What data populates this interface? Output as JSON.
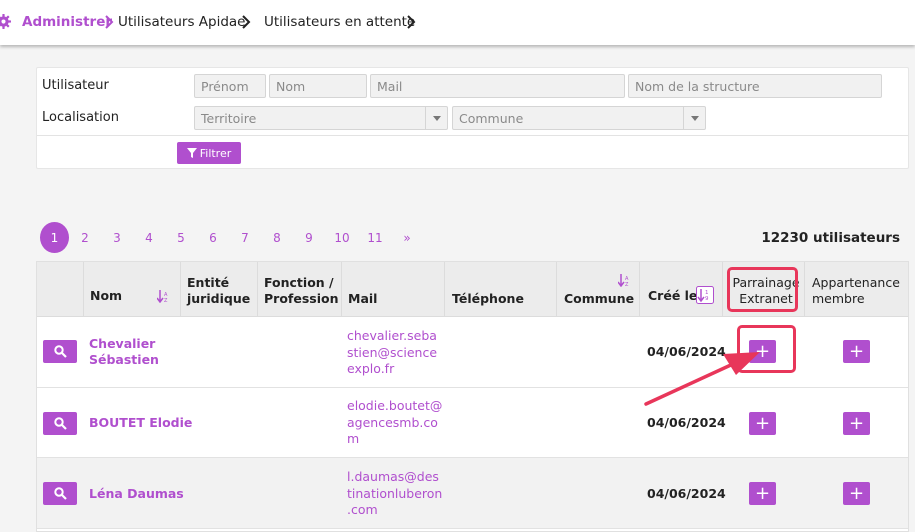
{
  "breadcrumb": {
    "items": [
      "Administrer",
      "Utilisateurs Apidae",
      "Utilisateurs en attente"
    ]
  },
  "filters": {
    "user_label": "Utilisateur",
    "location_label": "Localisation",
    "firstname_placeholder": "Prénom",
    "lastname_placeholder": "Nom",
    "mail_placeholder": "Mail",
    "structure_placeholder": "Nom de la structure",
    "territory_placeholder": "Territoire",
    "commune_placeholder": "Commune",
    "filter_button": "Filtrer"
  },
  "pagination": {
    "pages": [
      "1",
      "2",
      "3",
      "4",
      "5",
      "6",
      "7",
      "8",
      "9",
      "10",
      "11",
      "»"
    ],
    "active": "1"
  },
  "count_text": "12230 utilisateurs",
  "table": {
    "headers": {
      "nom": "Nom",
      "entite": "Entité juridique",
      "fonction": "Fonction / Profession",
      "mail": "Mail",
      "telephone": "Téléphone",
      "commune": "Commune",
      "cree_le": "Créé le",
      "parrainage": "Parrainage Extranet",
      "appartenance": "Appartenance membre"
    },
    "rows": [
      {
        "name_line1": "Chevalier",
        "name_line2": "Sébastien",
        "mail_lines": [
          "chevalier.seba",
          "stien@science",
          "explo.fr"
        ],
        "date": "04/06/2024",
        "plus": "+"
      },
      {
        "name_line1": "BOUTET Elodie",
        "name_line2": "",
        "mail_lines": [
          "elodie.boutet@",
          "agencesmb.co",
          "m"
        ],
        "date": "04/06/2024",
        "plus": "+"
      },
      {
        "name_line1": "Léna Daumas",
        "name_line2": "",
        "mail_lines": [
          "l.daumas@des",
          "tinationluberon",
          ".com"
        ],
        "date": "04/06/2024",
        "plus": "+"
      }
    ]
  },
  "colors": {
    "accent": "#b04fce",
    "highlight": "#e8365a"
  },
  "icons": [
    "gear-icon",
    "chevron-right-icon",
    "filter-icon",
    "search-icon",
    "sort-icon",
    "caret-down-icon",
    "plus-icon",
    "annotation-arrow-icon"
  ]
}
